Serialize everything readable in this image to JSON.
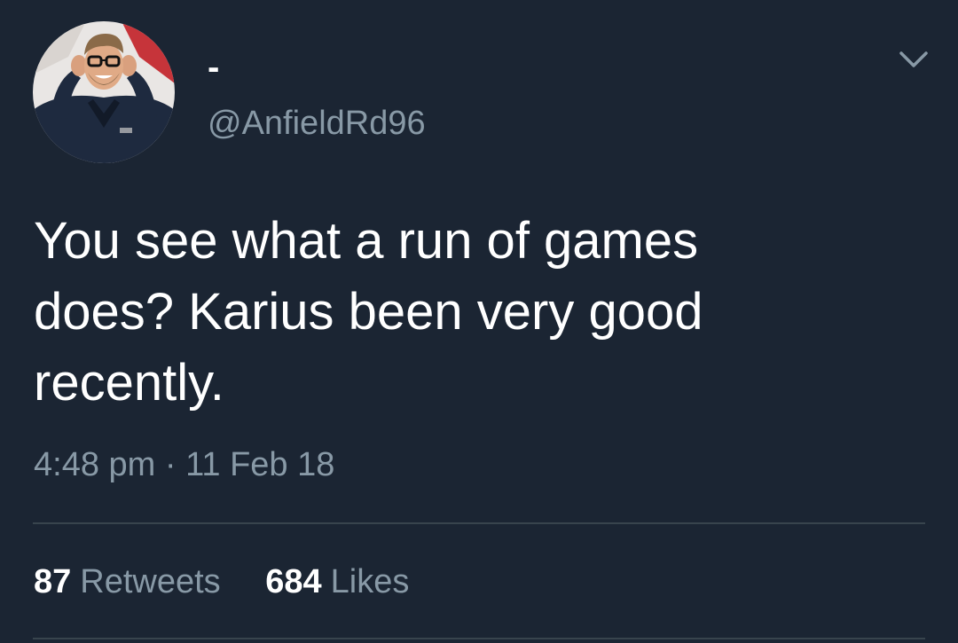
{
  "user": {
    "display_name": "-",
    "handle": "@AnfieldRd96"
  },
  "tweet": {
    "text_lines": [
      "You see what a run of games",
      "does? Karius been very good",
      "recently."
    ],
    "timestamp": "4:48 pm · 11 Feb 18"
  },
  "stats": {
    "retweets_count": "87",
    "retweets_label": "Retweets",
    "likes_count": "684",
    "likes_label": "Likes"
  },
  "icons": {
    "menu": "chevron-down-icon"
  },
  "colors": {
    "background": "#1b2533",
    "primary_text": "#ffffff",
    "secondary_text": "#8899a6",
    "divider": "#38444d"
  }
}
